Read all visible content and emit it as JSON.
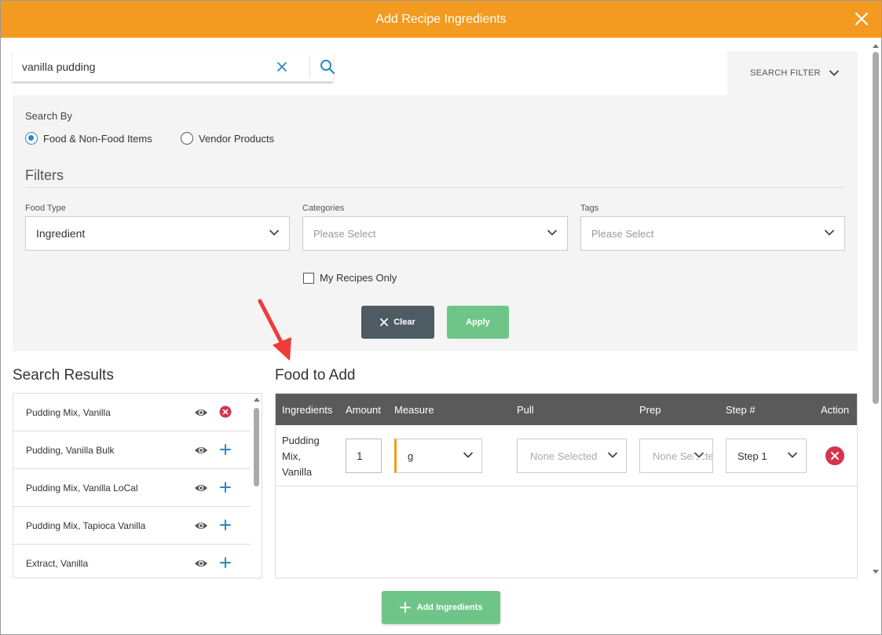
{
  "header": {
    "title": "Add Recipe Ingredients"
  },
  "search": {
    "value": "vanilla pudding"
  },
  "search_filter": {
    "label": "SEARCH FILTER"
  },
  "search_by": {
    "label": "Search By",
    "options": [
      {
        "label": "Food & Non-Food Items",
        "selected": true
      },
      {
        "label": "Vendor Products",
        "selected": false
      }
    ]
  },
  "filters": {
    "title": "Filters",
    "food_type": {
      "label": "Food Type",
      "value": "Ingredient"
    },
    "categories": {
      "label": "Categories",
      "placeholder": "Please Select"
    },
    "tags": {
      "label": "Tags",
      "placeholder": "Please Select"
    },
    "my_recipes_only": {
      "label": "My Recipes Only",
      "checked": false
    },
    "clear_label": "Clear",
    "apply_label": "Apply"
  },
  "search_results": {
    "title": "Search Results",
    "items": [
      {
        "name": "Pudding Mix, Vanilla",
        "action": "remove"
      },
      {
        "name": "Pudding, Vanilla Bulk",
        "action": "add"
      },
      {
        "name": "Pudding Mix, Vanilla LoCal",
        "action": "add"
      },
      {
        "name": "Pudding Mix, Tapioca Vanilla",
        "action": "add"
      },
      {
        "name": "Extract, Vanilla",
        "action": "add"
      }
    ]
  },
  "food_to_add": {
    "title": "Food to Add",
    "columns": [
      "Ingredients",
      "Amount",
      "Measure",
      "Pull",
      "Prep",
      "Step #",
      "Action"
    ],
    "rows": [
      {
        "ingredient_lines": [
          "Pudding",
          "Mix,",
          "Vanilla"
        ],
        "amount": "1",
        "measure": "g",
        "pull": "None Selected",
        "prep": "None Selected",
        "step": "Step 1"
      }
    ]
  },
  "footer": {
    "add_label": "Add Ingredients"
  },
  "colors": {
    "header": "#f39a21",
    "primary_green": "#6fc587",
    "dark_button": "#4f5b63",
    "accent_blue": "#2e86c1",
    "danger": "#d6334f"
  }
}
